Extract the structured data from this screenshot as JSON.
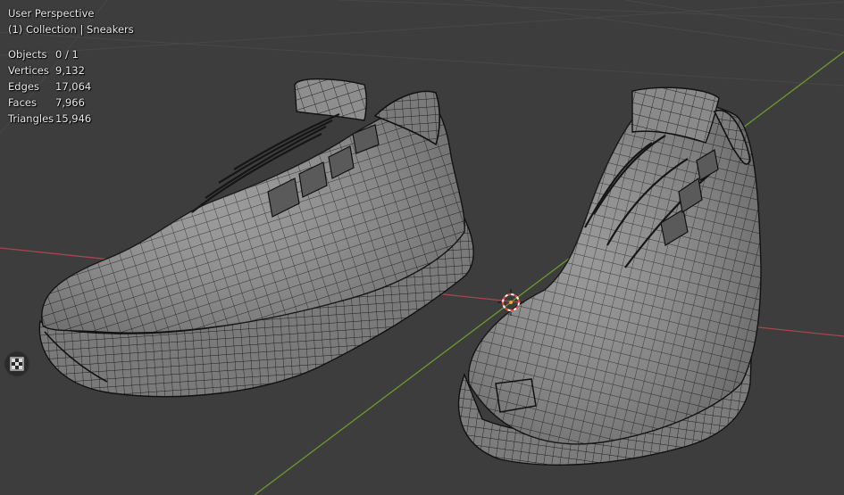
{
  "viewport": {
    "view_name": "User Perspective",
    "collection_line": "(1) Collection | Sneakers"
  },
  "stats": [
    {
      "label": "Objects",
      "value": "0 / 1"
    },
    {
      "label": "Vertices",
      "value": "9,132"
    },
    {
      "label": "Edges",
      "value": "17,064"
    },
    {
      "label": "Faces",
      "value": "7,966"
    },
    {
      "label": "Triangles",
      "value": "15,946"
    }
  ],
  "tools": {
    "toggle_icon": "checkerboard-toggle-icon"
  },
  "colors": {
    "background": "#3d3d3d",
    "grid_line": "#4a4a4a",
    "x_axis": "#a8454f",
    "y_axis": "#6c9a2d",
    "mesh_fill": "#8a8a8a",
    "mesh_wire": "#1e1e1e",
    "cursor_red": "#e44b3c"
  }
}
